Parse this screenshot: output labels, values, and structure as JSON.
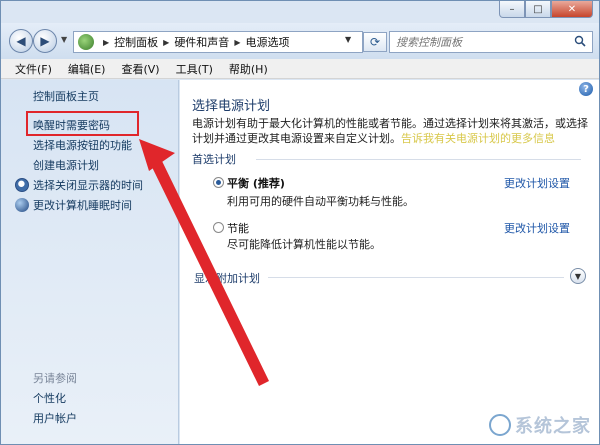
{
  "window": {
    "caption": {
      "minimize": "–",
      "maximize": "□",
      "close": "✕"
    }
  },
  "address_bar": {
    "crumbs": [
      "控制面板",
      "硬件和声音",
      "电源选项"
    ],
    "search_placeholder": "搜索控制面板"
  },
  "menu": [
    "文件(F)",
    "编辑(E)",
    "查看(V)",
    "工具(T)",
    "帮助(H)"
  ],
  "sidebar": {
    "home": "控制面板主页",
    "links": [
      "唤醒时需要密码",
      "选择电源按钮的功能",
      "创建电源计划",
      "选择关闭显示器的时间",
      "更改计算机睡眠时间"
    ],
    "see_also_title": "另请参阅",
    "see_also": [
      "个性化",
      "用户帐户"
    ]
  },
  "main": {
    "title": "选择电源计划",
    "desc_1": "电源计划有助于最大化计算机的性能或者节能。通过选择计划来将其激活，或选择计划并通过更改其电源设置来自定义计划。",
    "desc_link": "告诉我有关电源计划的更多信息",
    "preferred_label": "首选计划",
    "plans": [
      {
        "name": "平衡 (推荐)",
        "desc": "利用可用的硬件自动平衡功耗与性能。",
        "link": "更改计划设置",
        "selected": true
      },
      {
        "name": "节能",
        "desc": "尽可能降低计算机性能以节能。",
        "link": "更改计划设置",
        "selected": false
      }
    ],
    "more_plans": "显示附加计划"
  },
  "watermark": "系统之家",
  "colors": {
    "highlight": "#e0262b",
    "link": "#1f57a8"
  }
}
